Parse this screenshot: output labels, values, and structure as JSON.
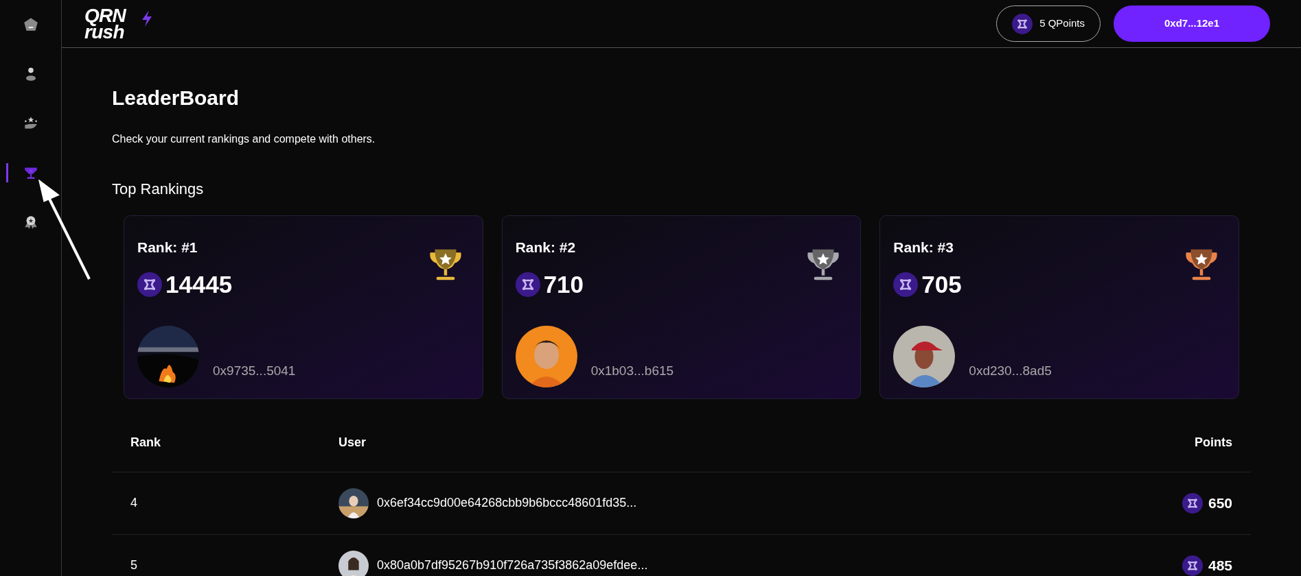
{
  "sidebar": {
    "items": [
      {
        "kind": "home",
        "selected": false
      },
      {
        "kind": "profile",
        "selected": false
      },
      {
        "kind": "rewards",
        "selected": false
      },
      {
        "kind": "leaderboard",
        "selected": true
      },
      {
        "kind": "badges",
        "selected": false
      }
    ]
  },
  "header": {
    "logo": {
      "top": "QRN",
      "bottom": "rush"
    },
    "points": "5 QPoints",
    "wallet": "0xd7...12e1"
  },
  "page": {
    "title": "LeaderBoard",
    "subtitle": "Check your current rankings and compete with others."
  },
  "top_rankings": {
    "title": "Top Rankings",
    "cards": [
      {
        "rank": "Rank: #1",
        "points": "14445",
        "address": "0x9735...5041",
        "color": "#e8b93c"
      },
      {
        "rank": "Rank: #2",
        "points": "710",
        "address": "0x1b03...b615",
        "color": "#a8a8ad"
      },
      {
        "rank": "Rank: #3",
        "points": "705",
        "address": "0xd230...8ad5",
        "color": "#e9834a"
      }
    ]
  },
  "table": {
    "columns": [
      "Rank",
      "User",
      "Points"
    ],
    "rows": [
      {
        "rank": "4",
        "user": "0x6ef34cc9d00e64268cbb9b6bccc48601fd35...",
        "points": "650"
      },
      {
        "rank": "5",
        "user": "0x80a0b7df95267b910f726a735f3862a09efdee...",
        "points": "485"
      }
    ]
  }
}
